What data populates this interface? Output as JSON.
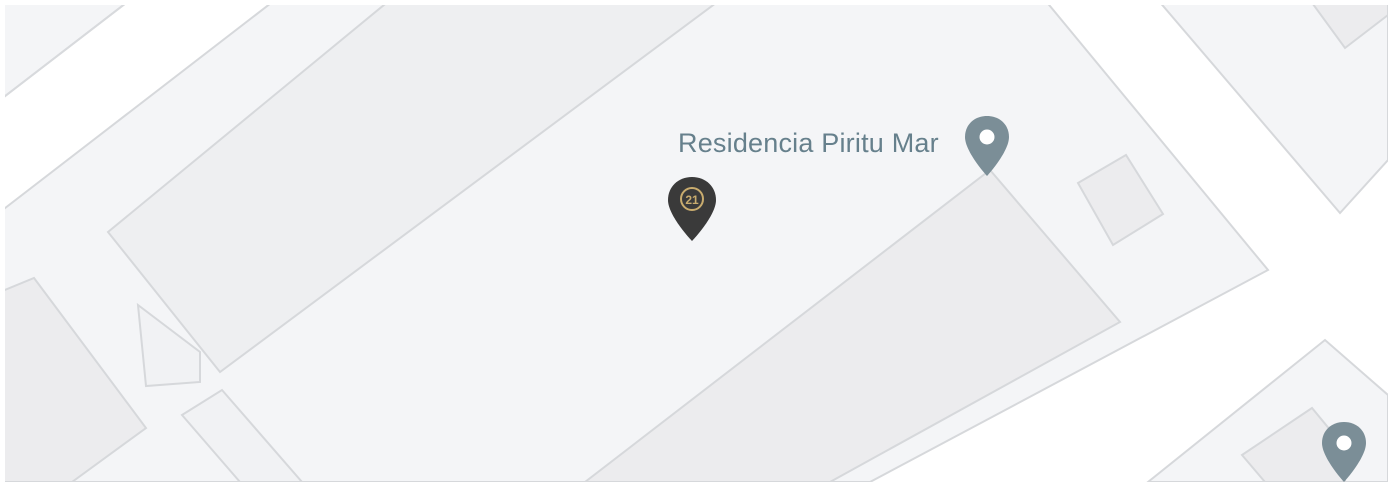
{
  "map": {
    "colors": {
      "land": "#f4f5f7",
      "block": "#ececee",
      "road": "#ffffff",
      "outline": "#d6d8db",
      "poi_pin": "#7b8e97",
      "listing_pin": "#3a3a3a",
      "listing_logo": "#c9ac6e",
      "label_text": "#66808c"
    }
  },
  "markers": {
    "residencia": {
      "label": "Residencia Piritu Mar",
      "icon": "location-pin-icon"
    },
    "listing": {
      "logo_text": "21",
      "icon": "century21-listing-pin-icon"
    },
    "corner_poi": {
      "icon": "location-pin-icon"
    }
  }
}
